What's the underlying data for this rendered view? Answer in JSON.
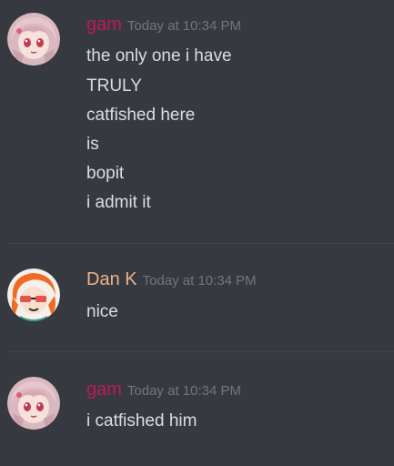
{
  "colors": {
    "background": "#36393f",
    "gam_name": "#c2185b",
    "dan_name": "#e8b38c",
    "timestamp": "#72767d",
    "message_text": "#dcddde"
  },
  "messages": [
    {
      "author": "gam",
      "timestamp": "Today at 10:34 PM",
      "avatar_icon": "anime-girl-pink-hair-avatar",
      "lines": [
        "the only one i have",
        "TRULY",
        "catfished here",
        "is",
        "bopit",
        "i admit it"
      ]
    },
    {
      "author": "Dan K",
      "timestamp": "Today at 10:34 PM",
      "avatar_icon": "orange-hair-sunglasses-avatar",
      "lines": [
        "nice"
      ]
    },
    {
      "author": "gam",
      "timestamp": "Today at 10:34 PM",
      "avatar_icon": "anime-girl-pink-hair-avatar",
      "lines": [
        "i catfished him"
      ]
    }
  ]
}
